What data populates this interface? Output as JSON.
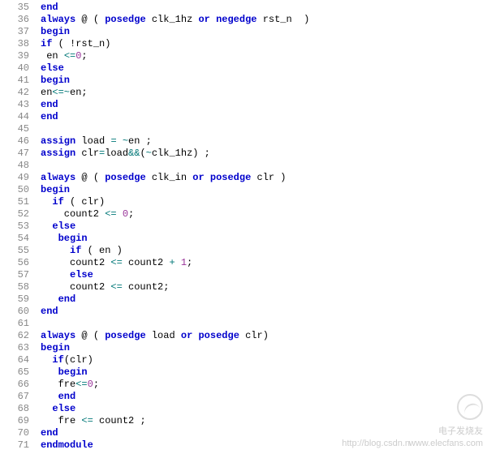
{
  "gutter": {
    "start": 35,
    "end": 71
  },
  "code_tokens": [
    [
      [
        "end",
        "kw"
      ]
    ],
    [
      [
        "always",
        "kw"
      ],
      [
        " @ ( ",
        ""
      ],
      [
        "posedge",
        "kw"
      ],
      [
        " clk_1hz ",
        ""
      ],
      [
        "or",
        "kw"
      ],
      [
        " ",
        ""
      ],
      [
        "negedge",
        "kw"
      ],
      [
        " rst_n  )",
        ""
      ]
    ],
    [
      [
        "begin",
        "kw"
      ]
    ],
    [
      [
        "if",
        "kw"
      ],
      [
        " ( !rst_n)",
        ""
      ]
    ],
    [
      [
        " en ",
        ""
      ],
      [
        "<=",
        "op"
      ],
      [
        "0",
        "num"
      ],
      [
        ";",
        ""
      ]
    ],
    [
      [
        "else",
        "kw"
      ]
    ],
    [
      [
        "begin",
        "kw"
      ]
    ],
    [
      [
        "en",
        ""
      ],
      [
        "<=~",
        "op"
      ],
      [
        "en;",
        ""
      ]
    ],
    [
      [
        "end",
        "kw"
      ]
    ],
    [
      [
        "end",
        "kw"
      ]
    ],
    [
      [
        "",
        ""
      ]
    ],
    [
      [
        "assign",
        "kw"
      ],
      [
        " load ",
        ""
      ],
      [
        "= ~",
        "op"
      ],
      [
        "en ;",
        ""
      ]
    ],
    [
      [
        "assign",
        "kw"
      ],
      [
        " clr",
        ""
      ],
      [
        "=",
        "op"
      ],
      [
        "load",
        ""
      ],
      [
        "&&",
        "op"
      ],
      [
        "(",
        ""
      ],
      [
        "~",
        "op"
      ],
      [
        "clk_1hz) ;",
        ""
      ]
    ],
    [
      [
        "",
        ""
      ]
    ],
    [
      [
        "always",
        "kw"
      ],
      [
        " @ ( ",
        ""
      ],
      [
        "posedge",
        "kw"
      ],
      [
        " clk_in ",
        ""
      ],
      [
        "or",
        "kw"
      ],
      [
        " ",
        ""
      ],
      [
        "posedge",
        "kw"
      ],
      [
        " clr )",
        ""
      ]
    ],
    [
      [
        "begin",
        "kw"
      ]
    ],
    [
      [
        "  ",
        ""
      ],
      [
        "if",
        "kw"
      ],
      [
        " ( clr)",
        ""
      ]
    ],
    [
      [
        "    count2 ",
        ""
      ],
      [
        "<=",
        "op"
      ],
      [
        " ",
        ""
      ],
      [
        "0",
        "num"
      ],
      [
        ";",
        ""
      ]
    ],
    [
      [
        "  ",
        ""
      ],
      [
        "else",
        "kw"
      ]
    ],
    [
      [
        "   ",
        ""
      ],
      [
        "begin",
        "kw"
      ]
    ],
    [
      [
        "     ",
        ""
      ],
      [
        "if",
        "kw"
      ],
      [
        " ( en )",
        ""
      ]
    ],
    [
      [
        "     count2 ",
        ""
      ],
      [
        "<=",
        "op"
      ],
      [
        " count2 ",
        ""
      ],
      [
        "+",
        "op"
      ],
      [
        " ",
        ""
      ],
      [
        "1",
        "num"
      ],
      [
        ";",
        ""
      ]
    ],
    [
      [
        "     ",
        ""
      ],
      [
        "else",
        "kw"
      ]
    ],
    [
      [
        "     count2 ",
        ""
      ],
      [
        "<=",
        "op"
      ],
      [
        " count2;",
        ""
      ]
    ],
    [
      [
        "   ",
        ""
      ],
      [
        "end",
        "kw"
      ]
    ],
    [
      [
        "end",
        "kw"
      ]
    ],
    [
      [
        "",
        ""
      ]
    ],
    [
      [
        "always",
        "kw"
      ],
      [
        " @ ( ",
        ""
      ],
      [
        "posedge",
        "kw"
      ],
      [
        " load ",
        ""
      ],
      [
        "or",
        "kw"
      ],
      [
        " ",
        ""
      ],
      [
        "posedge",
        "kw"
      ],
      [
        " clr)",
        ""
      ]
    ],
    [
      [
        "begin",
        "kw"
      ]
    ],
    [
      [
        "  ",
        ""
      ],
      [
        "if",
        "kw"
      ],
      [
        "(clr)",
        ""
      ]
    ],
    [
      [
        "   ",
        ""
      ],
      [
        "begin",
        "kw"
      ]
    ],
    [
      [
        "   fre",
        ""
      ],
      [
        "<=",
        "op"
      ],
      [
        "0",
        "num"
      ],
      [
        ";",
        ""
      ]
    ],
    [
      [
        "   ",
        ""
      ],
      [
        "end",
        "kw"
      ]
    ],
    [
      [
        "  ",
        ""
      ],
      [
        "else",
        "kw"
      ]
    ],
    [
      [
        "   fre ",
        ""
      ],
      [
        "<=",
        "op"
      ],
      [
        " count2 ;",
        ""
      ]
    ],
    [
      [
        "end",
        "kw"
      ]
    ],
    [
      [
        "endmodule",
        "kw"
      ]
    ]
  ],
  "watermark": {
    "line1": "电子发烧友",
    "line2": "http://blog.csdn.n",
    "line3": "www.elecfans.com"
  }
}
